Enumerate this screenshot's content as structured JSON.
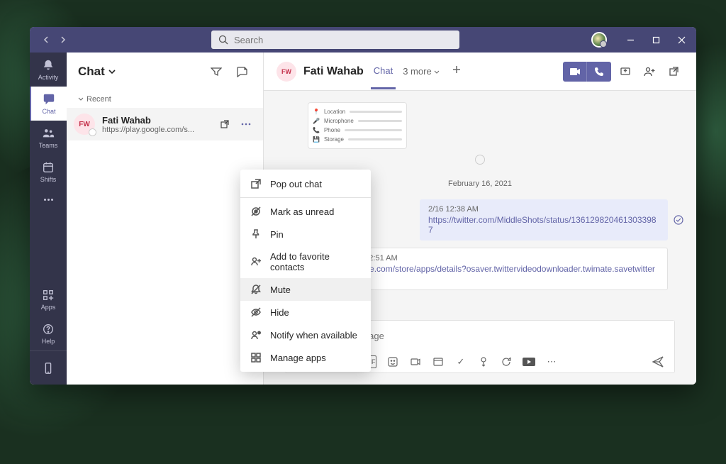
{
  "search": {
    "placeholder": "Search"
  },
  "rail": {
    "activity": "Activity",
    "chat": "Chat",
    "teams": "Teams",
    "shifts": "Shifts",
    "apps": "Apps",
    "help": "Help"
  },
  "chatList": {
    "title": "Chat",
    "section_recent": "Recent",
    "items": [
      {
        "initials": "FW",
        "name": "Fati Wahab",
        "preview": "https://play.google.com/s..."
      }
    ]
  },
  "conversation": {
    "avatar_initials": "FW",
    "title": "Fati Wahab",
    "tab_chat": "Chat",
    "tab_more": "3 more",
    "date_divider": "February 16, 2021",
    "messages": [
      {
        "time": "2/16 12:38 AM",
        "text": "https://twitter.com/MiddleShots/status/1361298204613033987",
        "type": "filled"
      },
      {
        "time": "6 12:51 AM",
        "text": "ogle.com/store/apps/details?osaver.twittervideodownloader.twimate.savetwittergif",
        "type": "plain"
      }
    ],
    "thumb_rows": [
      "Location",
      "Microphone",
      "Phone",
      "Storage"
    ],
    "composer_placeholder": "Type a new message"
  },
  "contextMenu": {
    "items": [
      {
        "icon": "popout",
        "label": "Pop out chat"
      },
      {
        "icon": "unread",
        "label": "Mark as unread"
      },
      {
        "icon": "pin",
        "label": "Pin"
      },
      {
        "icon": "favorite",
        "label": "Add to favorite contacts"
      },
      {
        "icon": "mute",
        "label": "Mute",
        "highlighted": true
      },
      {
        "icon": "hide",
        "label": "Hide"
      },
      {
        "icon": "notify",
        "label": "Notify when available"
      },
      {
        "icon": "apps",
        "label": "Manage apps"
      }
    ]
  }
}
